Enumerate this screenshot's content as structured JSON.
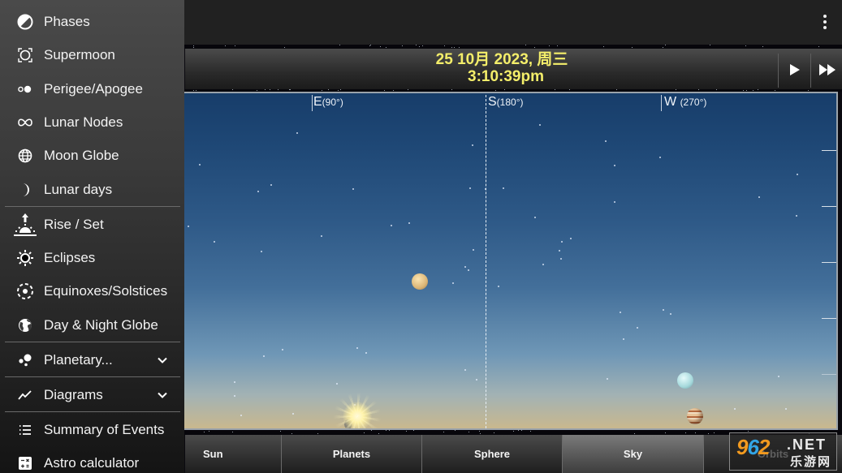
{
  "drawer": {
    "items": [
      {
        "label": "Phases",
        "icon": "half-circle-icon"
      },
      {
        "label": "Supermoon",
        "icon": "supermoon-icon"
      },
      {
        "label": "Perigee/Apogee",
        "icon": "perigee-apogee-icon"
      },
      {
        "label": "Lunar Nodes",
        "icon": "infinity-icon"
      },
      {
        "label": "Moon Globe",
        "icon": "globe-icon"
      },
      {
        "label": "Lunar days",
        "icon": "crescent-moon-icon"
      },
      {
        "label": "Rise / Set",
        "icon": "sunrise-icon"
      },
      {
        "label": "Eclipses",
        "icon": "eclipse-icon"
      },
      {
        "label": "Equinoxes/Solstices",
        "icon": "equinox-icon"
      },
      {
        "label": "Day & Night Globe",
        "icon": "earth-globe-icon"
      },
      {
        "label": "Planetary...",
        "icon": "planets-icon",
        "expandable": true
      },
      {
        "label": "Diagrams",
        "icon": "line-chart-icon",
        "expandable": true
      },
      {
        "label": "Summary of Events",
        "icon": "list-icon"
      },
      {
        "label": "Astro calculator",
        "icon": "calculator-icon"
      }
    ]
  },
  "appbar": {
    "overflow_icon": "more-vert-icon"
  },
  "timebar": {
    "date": "25 10月 2023,  周三",
    "time": "3:10:39pm",
    "play_icon": "play-icon",
    "fast_forward_icon": "fast-forward-icon"
  },
  "sky": {
    "directions": [
      {
        "letter": "E",
        "degrees": "(90°)"
      },
      {
        "letter": "S",
        "degrees": "(180°)"
      },
      {
        "letter": "W",
        "degrees": "(270°)"
      }
    ],
    "bodies": [
      "Sun",
      "Moon",
      "Venus",
      "Uranus",
      "Jupiter"
    ]
  },
  "tabs": [
    {
      "label": "Sun",
      "active": false
    },
    {
      "label": "Planets",
      "active": false
    },
    {
      "label": "Sphere",
      "active": false
    },
    {
      "label": "Sky",
      "active": true
    },
    {
      "label": "Orbits",
      "active": false
    }
  ],
  "watermark": {
    "num_a": "9",
    "num_b": "6",
    "num_c": "2",
    "net": ".NET",
    "cn": "乐游网"
  },
  "colors": {
    "datetime": "#f4ee6a",
    "sky_top": "#173d6a",
    "sky_horizon": "#c9b88e"
  }
}
